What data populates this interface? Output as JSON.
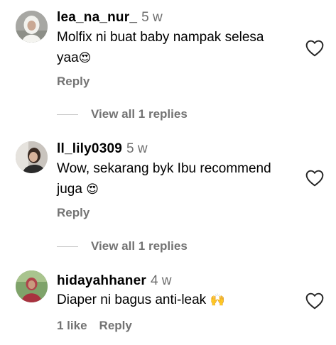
{
  "comments": [
    {
      "username": "lea_na_nur_",
      "time": "5 w",
      "text_line1": "Molfix ni buat baby nampak selesa",
      "text_line2": "yaa",
      "emoji": "😍",
      "reply_label": "Reply",
      "view_replies": "View all 1 replies"
    },
    {
      "username": "ll_lily0309",
      "time": "5 w",
      "text_line1": "Wow, sekarang byk Ibu recommend",
      "text_line2": "juga ",
      "emoji": "😍",
      "reply_label": "Reply",
      "view_replies": "View all 1 replies"
    },
    {
      "username": "hidayahhaner",
      "time": "4 w",
      "text_line1": "Diaper ni bagus anti-leak ",
      "emoji": "🙌",
      "likes": "1 like",
      "reply_label": "Reply"
    }
  ],
  "icons": {
    "like": "heart-outline-icon"
  },
  "colors": {
    "muted_text": "#737373",
    "timestamp": "#6f6f6f",
    "divider": "#c7c7c7"
  }
}
